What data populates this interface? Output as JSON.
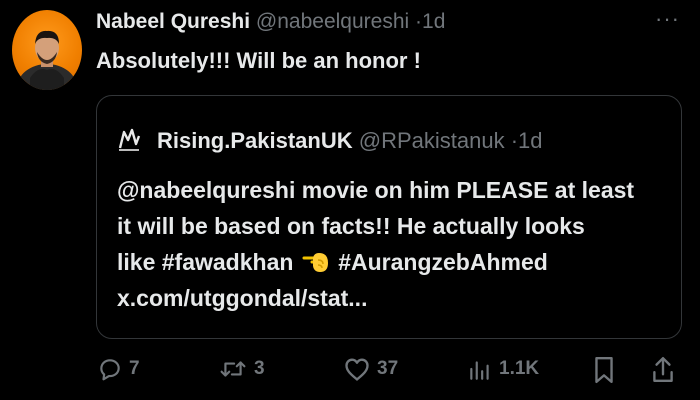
{
  "post": {
    "author_name": "Nabeel Qureshi",
    "author_handle": "@nabeelqureshi",
    "separator": "·",
    "time": "1d",
    "text": "Absolutely!!! Will be an honor !",
    "more_label": "···"
  },
  "quote": {
    "author_name": "Rising.PakistanUK",
    "author_handle": "@RPakistanuk",
    "separator": "·",
    "time": "1d",
    "lines": [
      "@nabeelqureshi movie on him PLEASE at least",
      "it will be based on facts!! He actually looks"
    ],
    "line3_before_emoji": "like #fawadkhan",
    "line3_after_emoji": "#AurangzebAhmed",
    "line4": "x.com/utggondal/stat..."
  },
  "actions": {
    "reply_count": "7",
    "repost_count": "3",
    "like_count": "37",
    "views_count": "1.1K"
  },
  "icons": [
    "reply-icon",
    "repost-icon",
    "like-icon",
    "views-icon",
    "bookmark-icon",
    "share-icon",
    "pointing-hand-emoji-icon"
  ],
  "colors": {
    "background": "#000000",
    "primary_text": "#e7e9ea",
    "secondary_text": "#71767b",
    "border": "#333639"
  }
}
